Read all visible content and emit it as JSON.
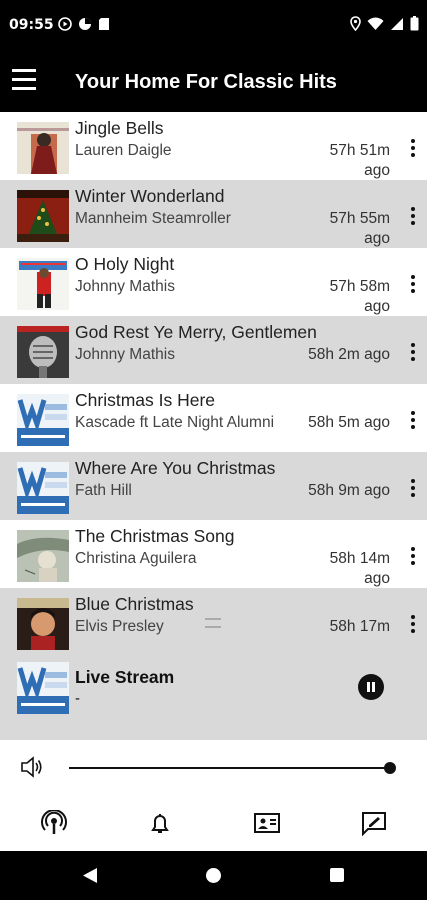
{
  "status_bar": {
    "time": "09:55"
  },
  "app_bar": {
    "title": "Your Home For Classic Hits"
  },
  "tracks": [
    {
      "title": "Jingle Bells",
      "artist": "Lauren Daigle",
      "time_line1": "57h 51m",
      "time_line2": "ago"
    },
    {
      "title": "Winter Wonderland",
      "artist": "Mannheim Steamroller",
      "time_line1": "57h 55m",
      "time_line2": "ago"
    },
    {
      "title": "O Holy Night",
      "artist": "Johnny Mathis",
      "time_line1": "57h 58m",
      "time_line2": "ago"
    },
    {
      "title": "God Rest Ye Merry, Gentlemen",
      "artist": "Johnny Mathis",
      "time": "58h 2m ago"
    },
    {
      "title": "Christmas Is Here",
      "artist": "Kascade ft Late Night Alumni",
      "time": "58h 5m ago"
    },
    {
      "title": "Where Are You Christmas",
      "artist": "Fath Hill",
      "time": "58h 9m ago"
    },
    {
      "title": "The Christmas Song",
      "artist": "Christina Aguilera",
      "time_line1": "58h 14m",
      "time_line2": "ago"
    },
    {
      "title": "Blue Christmas",
      "artist": "Elvis Presley",
      "time": "58h 17m"
    }
  ],
  "player": {
    "title": "Live Stream",
    "subtitle": "-",
    "state": "playing"
  },
  "volume": {
    "level": 1.0
  },
  "bottom_nav": [
    "podcast-icon",
    "bell-icon",
    "contact-card-icon",
    "chat-icon"
  ],
  "colors": {
    "bar_bg": "#000000",
    "alt_row": "#d9d9d9",
    "logo_blue": "#2f6db5"
  }
}
